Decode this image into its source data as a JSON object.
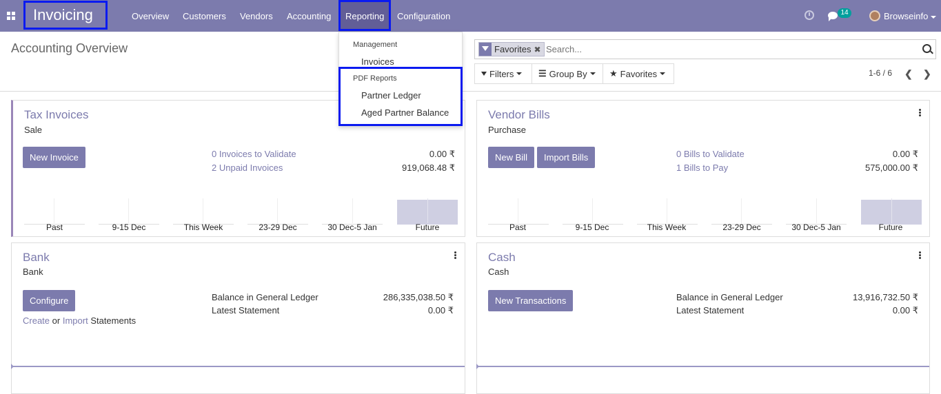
{
  "topbar": {
    "brand": "Invoicing",
    "menu": [
      "Overview",
      "Customers",
      "Vendors",
      "Accounting",
      "Reporting",
      "Configuration"
    ],
    "message_count": "14",
    "user": "Browseinfo",
    "accent_color": "#7c7bad",
    "highlight_color": "#0a1af0"
  },
  "control_panel": {
    "title": "Accounting Overview",
    "facet": "Favorites",
    "search_placeholder": "Search...",
    "filters": "Filters",
    "group_by": "Group By",
    "favorites": "Favorites",
    "pager": "1-6 / 6"
  },
  "reporting_menu": {
    "management_header": "Management",
    "invoices": "Invoices",
    "pdf_header": "PDF Reports",
    "partner_ledger": "Partner Ledger",
    "aged_partner_balance": "Aged Partner Balance"
  },
  "cards": {
    "tax_invoices": {
      "title": "Tax Invoices",
      "subtitle": "Sale",
      "button": "New Invoice",
      "link1": "0 Invoices to Validate",
      "amount1": "0.00 ₹",
      "link2": "2 Unpaid Invoices",
      "amount2": "919,068.48 ₹",
      "chart_labels": [
        "Past",
        "9-15 Dec",
        "This Week",
        "23-29 Dec",
        "30 Dec-5 Jan",
        "Future"
      ]
    },
    "vendor_bills": {
      "title": "Vendor Bills",
      "subtitle": "Purchase",
      "button1": "New Bill",
      "button2": "Import Bills",
      "link1": "0 Bills to Validate",
      "amount1": "0.00 ₹",
      "link2": "1 Bills to Pay",
      "amount2": "575,000.00 ₹",
      "chart_labels": [
        "Past",
        "9-15 Dec",
        "This Week",
        "23-29 Dec",
        "30 Dec-5 Jan",
        "Future"
      ]
    },
    "bank": {
      "title": "Bank",
      "subtitle": "Bank",
      "button": "Configure",
      "create": "Create",
      "or": "or",
      "import": "Import",
      "statements": "Statements",
      "label1": "Balance in General Ledger",
      "amount1": "286,335,038.50 ₹",
      "label2": "Latest Statement",
      "amount2": "0.00 ₹"
    },
    "cash": {
      "title": "Cash",
      "subtitle": "Cash",
      "button": "New Transactions",
      "label1": "Balance in General Ledger",
      "amount1": "13,916,732.50 ₹",
      "label2": "Latest Statement",
      "amount2": "0.00 ₹"
    }
  }
}
